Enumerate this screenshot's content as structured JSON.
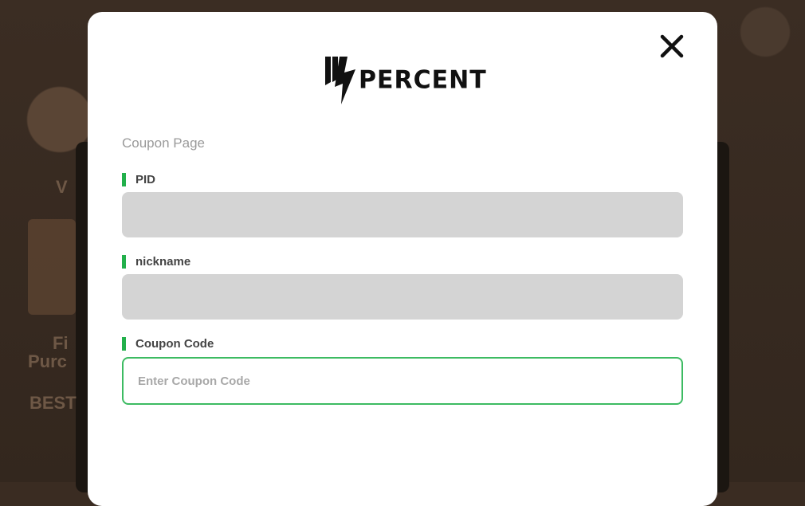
{
  "modal": {
    "logo_text": "PERCENT",
    "page_label": "Coupon Page",
    "close_icon": "close-icon"
  },
  "fields": {
    "pid_label": "PID",
    "pid_value": "",
    "nickname_label": "nickname",
    "nickname_value": "",
    "coupon_label": "Coupon Code",
    "coupon_placeholder": "Enter Coupon Code"
  },
  "background": {
    "text_fi": "Fi",
    "text_purc": "Purc",
    "text_best": "BEST",
    "text_v": "V"
  },
  "colors": {
    "accent": "#22b04b",
    "input_border": "#3dbb62",
    "readonly_field": "#d4d4d4"
  }
}
